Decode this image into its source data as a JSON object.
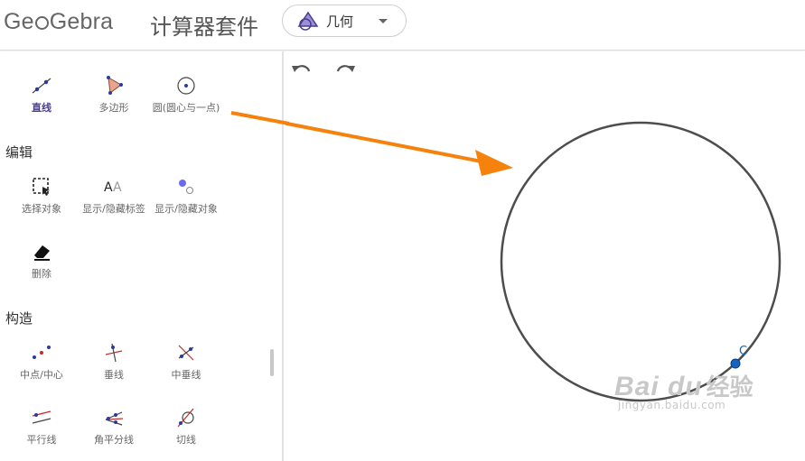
{
  "header": {
    "logo_text": "GeoGebra",
    "suite_title": "计算器套件",
    "app_select": {
      "label": "几何"
    }
  },
  "toolbar": {
    "undo_icon": "undo-icon",
    "redo_icon": "redo-icon"
  },
  "sidebar": {
    "basic_tools": [
      {
        "label": "直线",
        "icon": "line-icon",
        "active": true
      },
      {
        "label": "多边形",
        "icon": "polygon-icon"
      },
      {
        "label": "圆(圆心与一点)",
        "icon": "circle-center-point-icon"
      }
    ],
    "sections": [
      {
        "title": "编辑",
        "tools": [
          {
            "label": "选择对象",
            "icon": "select-objects-icon"
          },
          {
            "label": "显示/隐藏标签",
            "icon": "show-hide-label-icon"
          },
          {
            "label": "显示/隐藏对象",
            "icon": "show-hide-object-icon"
          },
          {
            "label": "删除",
            "icon": "eraser-icon"
          }
        ]
      },
      {
        "title": "构造",
        "tools": [
          {
            "label": "中点/中心",
            "icon": "midpoint-icon"
          },
          {
            "label": "垂线",
            "icon": "perpendicular-line-icon"
          },
          {
            "label": "中垂线",
            "icon": "perpendicular-bisector-icon"
          },
          {
            "label": "平行线",
            "icon": "parallel-line-icon"
          },
          {
            "label": "角平分线",
            "icon": "angle-bisector-icon"
          },
          {
            "label": "切线",
            "icon": "tangent-icon"
          }
        ]
      }
    ]
  },
  "canvas": {
    "point_label": "C",
    "colors": {
      "circle": "#4d4d4d",
      "point": "#1565c0",
      "arrow": "#f5820d",
      "accent": "#4b3d8c"
    }
  },
  "watermark": {
    "brand": "Bai du",
    "brand_cn": "经验",
    "url": "jingyan.baidu.com"
  }
}
